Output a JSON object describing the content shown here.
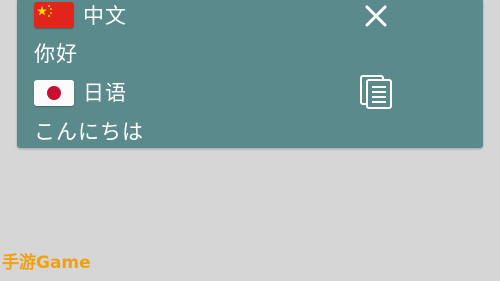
{
  "translation": {
    "source_language": "中文",
    "source_flag": "china-flag-icon",
    "source_text": "你好",
    "target_language": "日语",
    "target_flag": "japan-flag-icon",
    "target_text": "こんにちは",
    "close_icon": "close-icon",
    "copy_icon": "copy-icon"
  },
  "colors": {
    "card_background": "#5a8a8c",
    "page_background": "#d6d6d6",
    "text": "#ffffff",
    "watermark": "#f0a010"
  },
  "watermark": {
    "text": "手游Game"
  }
}
